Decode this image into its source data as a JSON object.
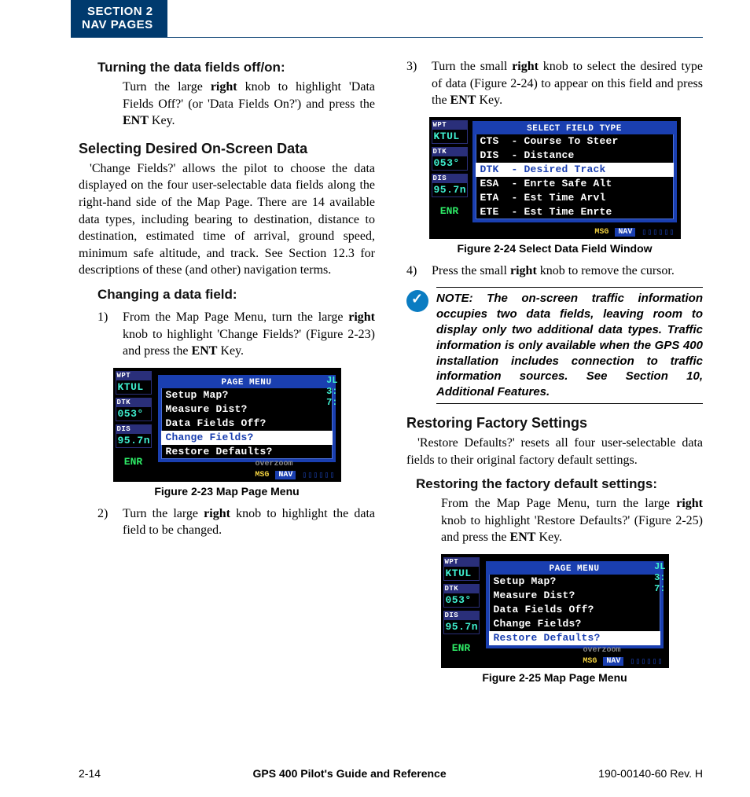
{
  "header": {
    "line1": "SECTION 2",
    "line2": "NAV PAGES"
  },
  "left": {
    "sub1_title": "Turning the data fields off/on:",
    "sub1_body_pre": "Turn the large ",
    "sub1_body_b1": "right",
    "sub1_body_mid": " knob to highlight 'Data Fields Off?' (or 'Data Fields On?') and press the ",
    "sub1_body_b2": "ENT",
    "sub1_body_post": " Key.",
    "main1_title": "Selecting Desired On-Screen Data",
    "main1_body": "'Change Fields?' allows the pilot to choose the data displayed on the four user-selectable data fields along the right-hand side of the Map Page.  There are 14 available data types, including bearing to destination, distance to destination, estimated time of arrival, ground speed, minimum safe altitude, and track.  See Section 12.3 for descriptions of these (and other) navigation terms.",
    "sub2_title": "Changing a data field:",
    "step1_num": "1)",
    "step1_pre": "From the Map Page Menu, turn the large ",
    "step1_b1": "right",
    "step1_mid": " knob to highlight 'Change Fields?' (Figure 2-23) and press the ",
    "step1_b2": "ENT",
    "step1_post": " Key.",
    "fig1_caption": "Figure 2-23  Map Page Menu",
    "step2_num": "2)",
    "step2_pre": "Turn the large ",
    "step2_b1": "right",
    "step2_post": " knob to highlight the data field to be changed."
  },
  "right": {
    "step3_num": "3)",
    "step3_pre": "Turn the small ",
    "step3_b1": "right",
    "step3_mid": " knob to select the desired type of data (Figure 2-24) to appear on this field and press the ",
    "step3_b2": "ENT",
    "step3_post": " Key.",
    "fig2_caption": "Figure 2-24  Select Data Field Window",
    "step4_num": "4)",
    "step4_pre": "Press the small ",
    "step4_b1": "right",
    "step4_post": " knob to remove the cursor.",
    "note": "NOTE:  The on-screen traffic information occupies two data fields, leaving room to display only two additional data types.  Traffic information is only available when the GPS 400 installation includes connection to traffic information sources.  See Section 10, Additional Features.",
    "main2_title": "Restoring Factory Settings",
    "main2_body": "'Restore Defaults?' resets all four user-selectable data fields to their original factory default settings.",
    "sub3_title": "Restoring the factory default settings:",
    "sub3_body_pre": "From the Map Page Menu, turn the large ",
    "sub3_body_b1": "right",
    "sub3_body_mid": " knob to highlight 'Restore Defaults?' (Figure 2-25) and press the ",
    "sub3_body_b2": "ENT",
    "sub3_body_post": " Key.",
    "fig3_caption": "Figure 2-25  Map Page Menu"
  },
  "figs": {
    "side": {
      "wpt_lbl": "WPT",
      "wpt": "KTUL",
      "dtk_lbl": "DTK",
      "dtk": "053°",
      "dis_lbl": "DIS",
      "dis": "95.7n",
      "enr": "ENR"
    },
    "page_menu_title": "PAGE MENU",
    "page_menu_items": [
      "Setup Map?",
      "Measure Dist?",
      "Data Fields Off?",
      "Change Fields?",
      "Restore Defaults?"
    ],
    "page_menu_hl_1": 3,
    "page_menu_hl_3": 4,
    "field_type_title": "SELECT FIELD TYPE",
    "field_type_items": [
      {
        "code": "CTS",
        "desc": "Course To Steer"
      },
      {
        "code": "DIS",
        "desc": "Distance"
      },
      {
        "code": "DTK",
        "desc": "Desired Track"
      },
      {
        "code": "ESA",
        "desc": "Enrte Safe Alt"
      },
      {
        "code": "ETA",
        "desc": "Est Time Arvl"
      },
      {
        "code": "ETE",
        "desc": "Est Time Enrte"
      }
    ],
    "field_type_hl": 2,
    "bottom": {
      "msg": "MSG",
      "nav": "NAV",
      "bars": "▯▯▯▯▯▯"
    },
    "overzoom": "overzoom",
    "ghost": "JL\n3:\n7:"
  },
  "footer": {
    "left": "2-14",
    "center": "GPS 400 Pilot's Guide and Reference",
    "right": "190-00140-60  Rev. H"
  }
}
